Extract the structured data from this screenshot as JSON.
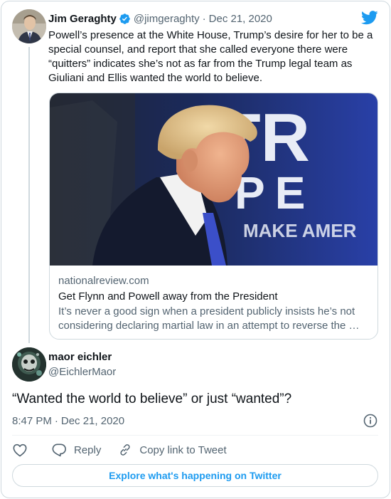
{
  "parent_tweet": {
    "author_name": "Jim Geraghty",
    "author_handle": "@jimgeraghty",
    "separator": "·",
    "date": "Dec 21, 2020",
    "text": "Powell’s presence at the White House, Trump’s desire for her to be a special counsel, and report that she called everyone there were “quitters” indicates she’s not as far from the Trump legal team as Giuliani and Ellis wanted the world to believe.",
    "verified_icon": "verified-badge-icon",
    "link_card": {
      "image_banner_text": [
        "TR",
        "PE",
        "MAKE AMER"
      ],
      "domain": "nationalreview.com",
      "title": "Get Flynn and Powell away from the President",
      "description_line1": "It’s never a good sign when a president publicly insists he’s not",
      "description_line2": "considering declaring martial law in an attempt to reverse the …"
    }
  },
  "reply_tweet": {
    "author_name": "maor eichler",
    "author_handle": "@EichlerMaor",
    "text": "“Wanted the world to believe” or just “wanted”?",
    "time": "8:47 PM",
    "separator": "·",
    "date": "Dec 21, 2020"
  },
  "actions": {
    "like_icon": "heart-icon",
    "reply_label": "Reply",
    "copy_label": "Copy link to Tweet"
  },
  "explore_label": "Explore what's happening on Twitter",
  "colors": {
    "accent": "#1d9bf0",
    "secondary_text": "#536471",
    "border": "#cfd9de"
  }
}
